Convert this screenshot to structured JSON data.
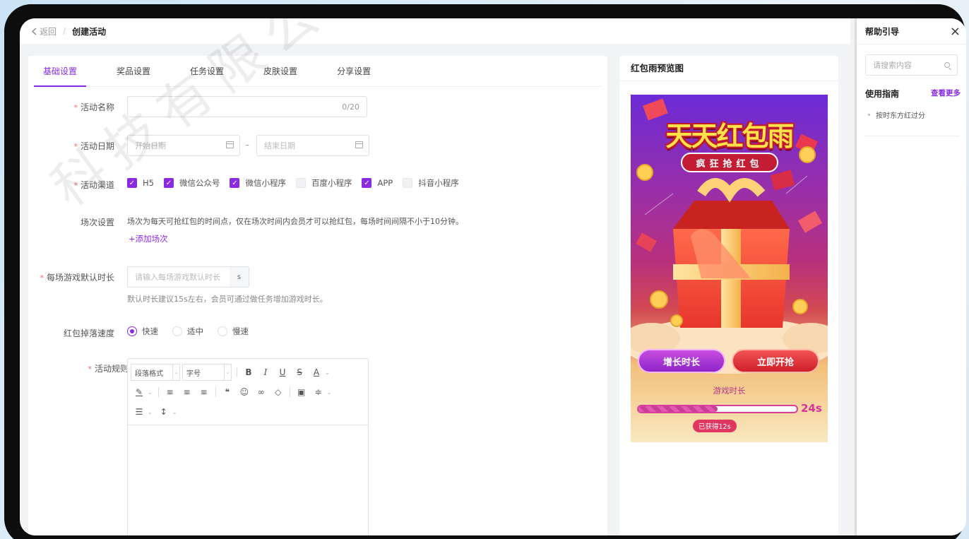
{
  "breadcrumb": {
    "back": "返回",
    "separator": "/",
    "current": "创建活动"
  },
  "watermark": "科技有限公司",
  "tabs": [
    {
      "label": "基础设置",
      "active": true
    },
    {
      "label": "奖品设置",
      "active": false
    },
    {
      "label": "任务设置",
      "active": false
    },
    {
      "label": "皮肤设置",
      "active": false
    },
    {
      "label": "分享设置",
      "active": false
    }
  ],
  "form": {
    "name": {
      "label": "活动名称",
      "counter": "0/20"
    },
    "date": {
      "label": "活动日期",
      "start_placeholder": "开始日期",
      "dash": "–",
      "end_placeholder": "结束日期"
    },
    "channel": {
      "label": "活动渠道",
      "options": [
        {
          "label": "H5",
          "checked": true
        },
        {
          "label": "微信公众号",
          "checked": true
        },
        {
          "label": "微信小程序",
          "checked": true
        },
        {
          "label": "百度小程序",
          "checked": false
        },
        {
          "label": "APP",
          "checked": true
        },
        {
          "label": "抖音小程序",
          "checked": false
        }
      ]
    },
    "session": {
      "label": "场次设置",
      "desc": "场次为每天可抢红包的时间点，仅在场次时间内会员才可以抢红包，每场时间间隔不小于10分钟。",
      "add": "+添加场次"
    },
    "duration": {
      "label": "每场游戏默认时长",
      "placeholder": "请输入每场游戏默认时长",
      "unit": "s",
      "hint": "默认时长建议15s左右，会员可通过做任务增加游戏时长。"
    },
    "speed": {
      "label": "红包掉落速度",
      "options": [
        {
          "label": "快速",
          "selected": true
        },
        {
          "label": "适中",
          "selected": false
        },
        {
          "label": "慢速",
          "selected": false
        }
      ]
    },
    "rules": {
      "label": "活动规则",
      "paragraph_select": "段落格式",
      "size_select": "字号"
    }
  },
  "preview": {
    "title": "红包雨预览图",
    "game_title": "天天红包雨",
    "game_subtitle": "疯狂抢红包",
    "btn_extend": "增长时长",
    "btn_grab": "立即开抢",
    "time_label": "游戏时长",
    "time_value": "24s",
    "earned": "已获得12s",
    "progress": 0.5
  },
  "help": {
    "title": "帮助引导",
    "close": "×",
    "search_placeholder": "请搜索内容",
    "guide_title": "使用指南",
    "more": "查看更多",
    "items": [
      "按时东方红过分"
    ]
  },
  "colors": {
    "accent": "#8a2be2",
    "required": "#f56c6c"
  }
}
